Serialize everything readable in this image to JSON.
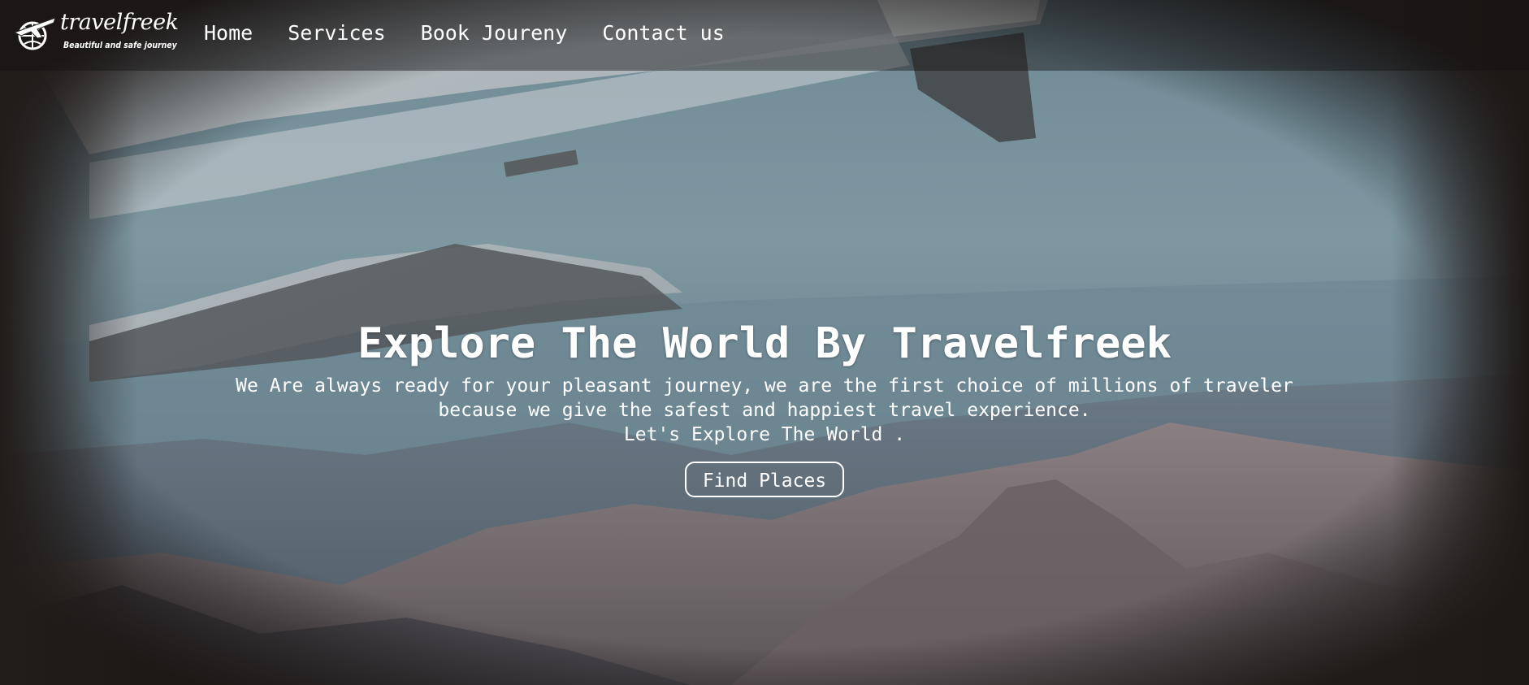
{
  "brand": {
    "name": "travelfreek",
    "tagline": "Beautiful and safe journey",
    "logo_icon": "airplane-globe-icon"
  },
  "nav": {
    "items": [
      {
        "label": "Home"
      },
      {
        "label": "Services"
      },
      {
        "label": "Book Joureny"
      },
      {
        "label": "Contact us"
      }
    ]
  },
  "hero": {
    "title": "Explore The World By Travelfreek",
    "description_line1": "We Are always ready for your pleasant journey, we are the first choice of millions of traveler",
    "description_line2": "because we give the safest and happiest travel experience.",
    "description_line3": "Let's Explore The World .",
    "cta_label": "Find Places",
    "background": "airplane-wing-over-mountains-image"
  },
  "colors": {
    "text": "#ffffff",
    "navbar_overlay": "#141212",
    "sky": "#7f9aa5",
    "mountain": "#6a6a70"
  }
}
